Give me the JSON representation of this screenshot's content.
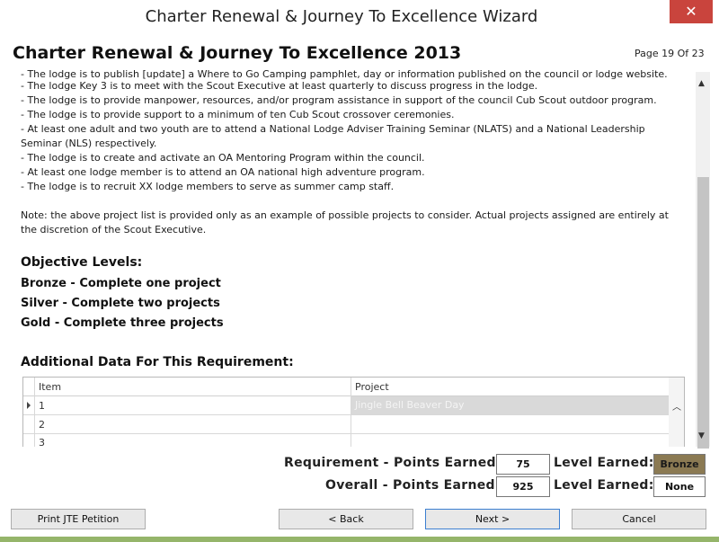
{
  "window": {
    "title": "Charter Renewal & Journey To Excellence Wizard",
    "close_symbol": "✕"
  },
  "page": {
    "title": "Charter Renewal & Journey To Excellence 2013",
    "page_indicator": "Page 19 Of 23"
  },
  "content": {
    "cut_line": "- The lodge is to publish [update] a Where to Go Camping pamphlet, day or information published on the council or lodge website.",
    "projects": [
      "- The lodge Key 3 is to meet with the Scout Executive at least quarterly to discuss progress in the lodge.",
      "- The lodge is to provide manpower, resources, and/or program assistance in support of the council Cub Scout outdoor program.",
      "- The lodge is to provide support to a minimum of ten Cub Scout crossover ceremonies.",
      "- At least one adult and two youth are to attend a National Lodge Adviser Training Seminar (NLATS) and a National Leadership",
      "Seminar (NLS) respectively.",
      "- The lodge is to create and activate an OA Mentoring Program within the council.",
      "- At least one lodge member is to attend an OA national high adventure program.",
      "- The lodge is to recruit XX lodge members to serve as summer camp staff."
    ],
    "note_lines": [
      "Note: the above project list is provided only as an example of possible projects to consider. Actual projects assigned are entirely at",
      "the discretion of the Scout Executive."
    ],
    "objective_heading": "Objective Levels:",
    "levels": [
      "Bronze - Complete one project",
      "Silver - Complete two projects",
      "Gold - Complete three projects"
    ],
    "additional_heading": "Additional Data For This Requirement:"
  },
  "grid": {
    "columns": [
      "Item",
      "Project"
    ],
    "rows": [
      {
        "item": "1",
        "project": "Jingle Bell Beaver Day"
      },
      {
        "item": "2",
        "project": ""
      },
      {
        "item": "3",
        "project": ""
      }
    ]
  },
  "scores": {
    "req_label": "Requirement - Points Earned:",
    "req_points": "75",
    "req_level_label": "Level Earned:",
    "req_level": "Bronze",
    "overall_label": "Overall - Points Earned:",
    "overall_points": "925",
    "overall_level_label": "Level Earned:",
    "overall_level": "None"
  },
  "buttons": {
    "print": "Print JTE Petition",
    "back": "< Back",
    "next": "Next >",
    "cancel": "Cancel"
  },
  "colors": {
    "bronze_bg": "#8b7a53",
    "close_bg": "#c9443d",
    "bottom_strip": "#95b56a"
  }
}
